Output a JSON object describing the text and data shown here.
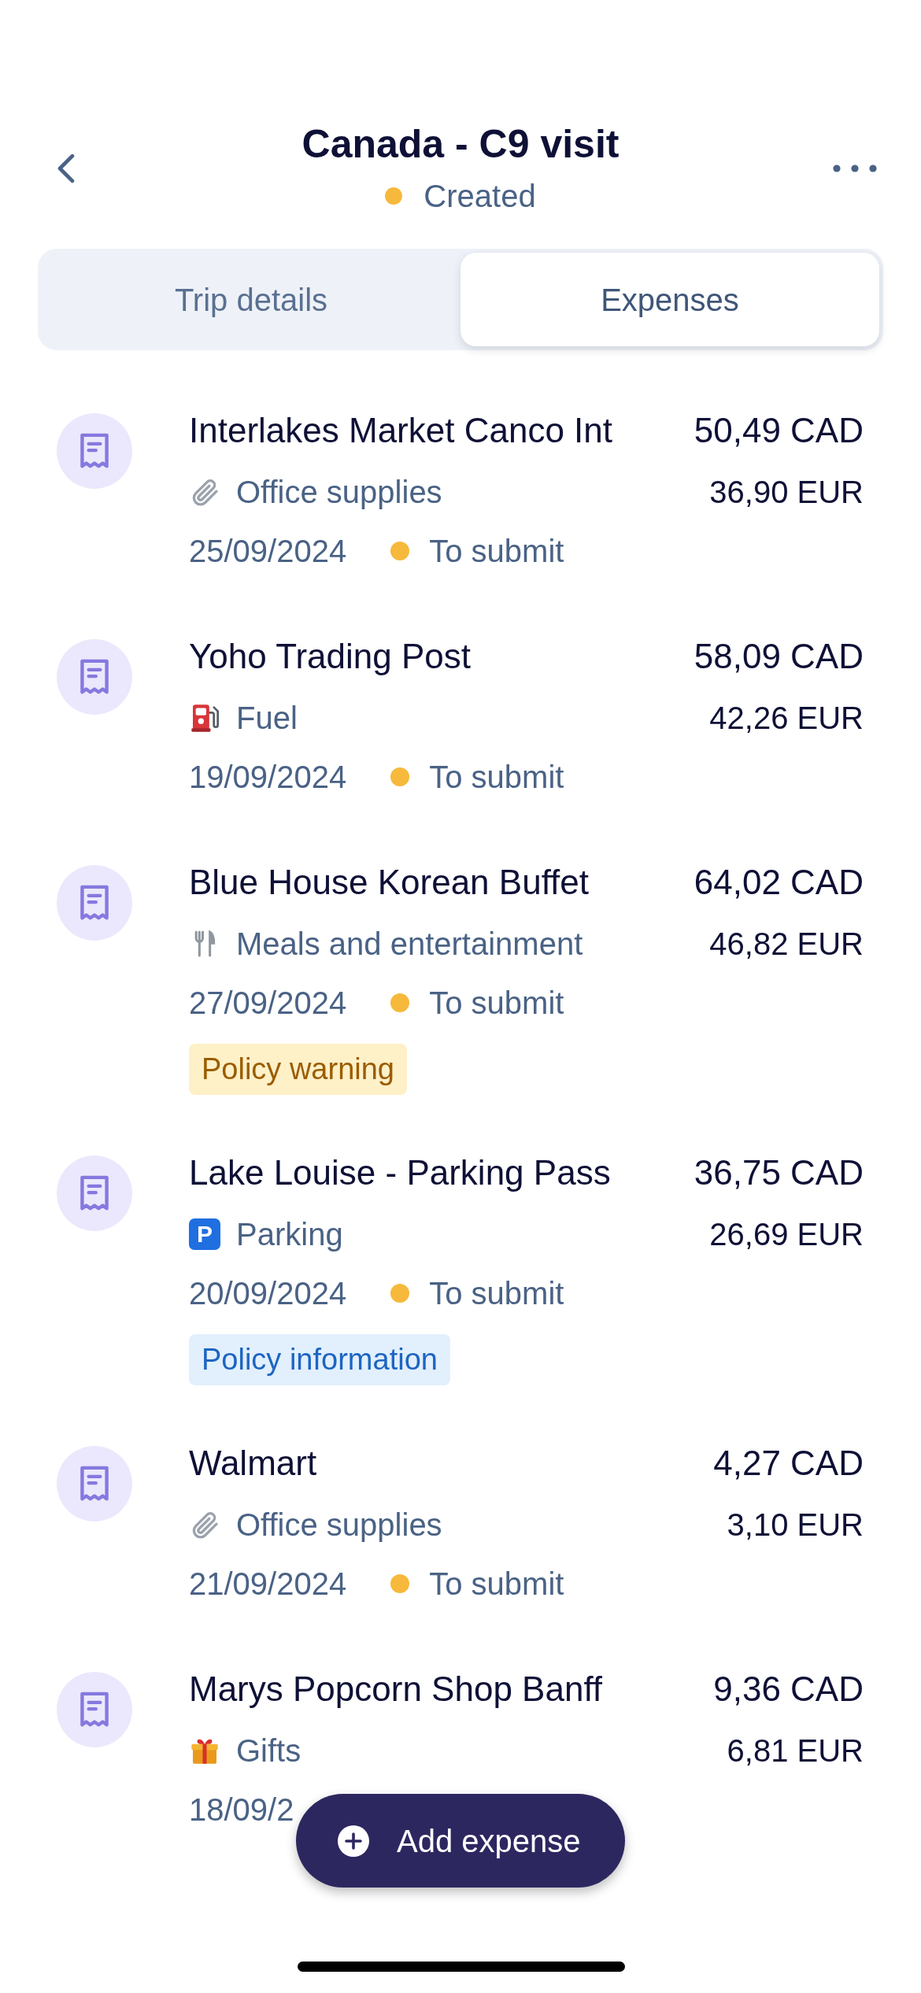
{
  "header": {
    "title": "Canada - C9 visit",
    "status": "Created"
  },
  "tabs": [
    {
      "label": "Trip details",
      "selected": false
    },
    {
      "label": "Expenses",
      "selected": true
    }
  ],
  "expenses": [
    {
      "merchant": "Interlakes Market Canco Int",
      "amount": "50,49 CAD",
      "category": {
        "label": "Office supplies",
        "kind": "office"
      },
      "converted_amount": "36,90 EUR",
      "date": "25/09/2024",
      "status": "To submit"
    },
    {
      "merchant": "Yoho Trading Post",
      "amount": "58,09 CAD",
      "category": {
        "label": "Fuel",
        "kind": "fuel"
      },
      "converted_amount": "42,26 EUR",
      "date": "19/09/2024",
      "status": "To submit"
    },
    {
      "merchant": "Blue House Korean Buffet",
      "amount": "64,02 CAD",
      "category": {
        "label": "Meals and entertainment",
        "kind": "meals"
      },
      "converted_amount": "46,82 EUR",
      "date": "27/09/2024",
      "status": "To submit",
      "badge": {
        "label": "Policy warning",
        "kind": "warning"
      }
    },
    {
      "merchant": "Lake Louise - Parking Pass",
      "amount": "36,75 CAD",
      "category": {
        "label": "Parking",
        "kind": "parking",
        "symbol": "P"
      },
      "converted_amount": "26,69 EUR",
      "date": "20/09/2024",
      "status": "To submit",
      "badge": {
        "label": "Policy information",
        "kind": "info"
      }
    },
    {
      "merchant": "Walmart",
      "amount": "4,27 CAD",
      "category": {
        "label": "Office supplies",
        "kind": "office"
      },
      "converted_amount": "3,10 EUR",
      "date": "21/09/2024",
      "status": "To submit"
    },
    {
      "merchant": "Marys Popcorn Shop Banff",
      "amount": "9,36 CAD",
      "category": {
        "label": "Gifts",
        "kind": "gifts"
      },
      "converted_amount": "6,81 EUR",
      "date": "18/09/2"
    }
  ],
  "add_button": {
    "label": "Add expense"
  }
}
